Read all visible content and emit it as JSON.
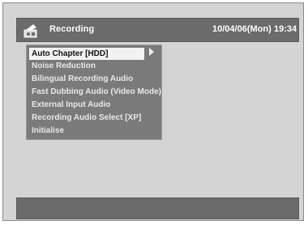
{
  "header": {
    "title": "Recording",
    "date": "10/04/06(Mon)",
    "time": "19:34",
    "icon": "recording-menu-icon"
  },
  "menu": {
    "items": [
      {
        "label": "Auto Chapter [HDD]",
        "selected": true
      },
      {
        "label": "Noise Reduction"
      },
      {
        "label": "Bilingual Recording Audio"
      },
      {
        "label": "Fast Dubbing Audio (Video Mode)"
      },
      {
        "label": "External Input Audio"
      },
      {
        "label": "Recording Audio Select [XP]"
      },
      {
        "label": "Initialise"
      }
    ],
    "submenu_indicator": "chevron-right-icon"
  },
  "status": {
    "text": ""
  },
  "colors": {
    "background": "#d4d4d4",
    "bar": "#6b6b6b",
    "menu": "#7a7a7a",
    "selected": "#f2f2f2"
  }
}
